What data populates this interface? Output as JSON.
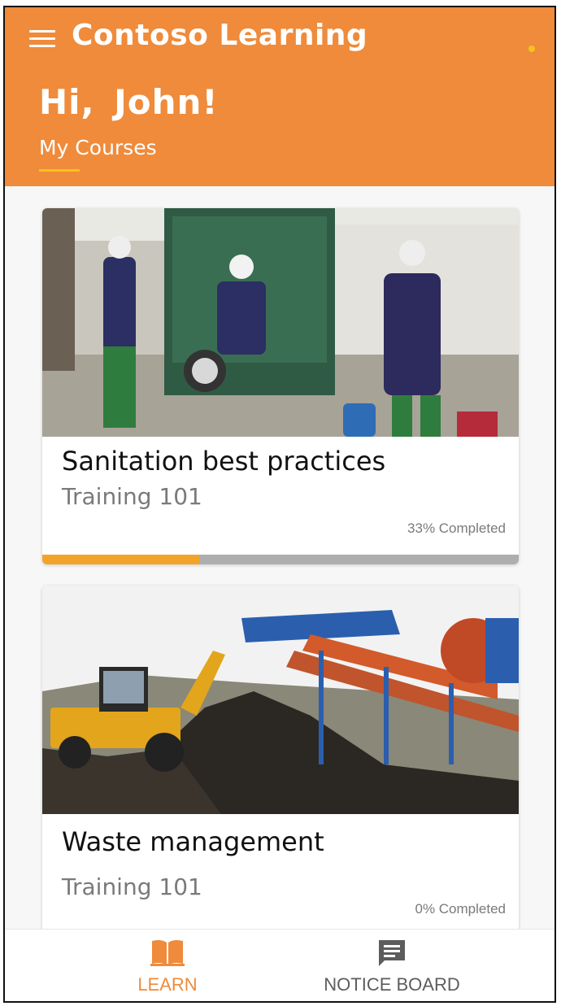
{
  "header": {
    "app_title": "Contoso Learning",
    "greeting": "Hi,  John!",
    "tab_label": "My Courses",
    "background_color": "#ef8b3b",
    "accent_color": "#f6c21c"
  },
  "courses": [
    {
      "title": "Sanitation best practices",
      "subtitle": "Training 101",
      "progress_text": "33% Completed",
      "progress": 0.33,
      "image": "sanitation-workers-photo"
    },
    {
      "title": "Waste management",
      "subtitle": "Training 101",
      "progress_text": "0% Completed",
      "progress": 0,
      "image": "waste-processing-photo"
    }
  ],
  "bottom_nav": {
    "items": [
      {
        "label": "LEARN",
        "icon": "book-icon",
        "active": true
      },
      {
        "label": "NOTICE BOARD",
        "icon": "message-icon",
        "active": false
      }
    ],
    "active_color": "#ef8b3b",
    "inactive_color": "#5d5d5d"
  }
}
